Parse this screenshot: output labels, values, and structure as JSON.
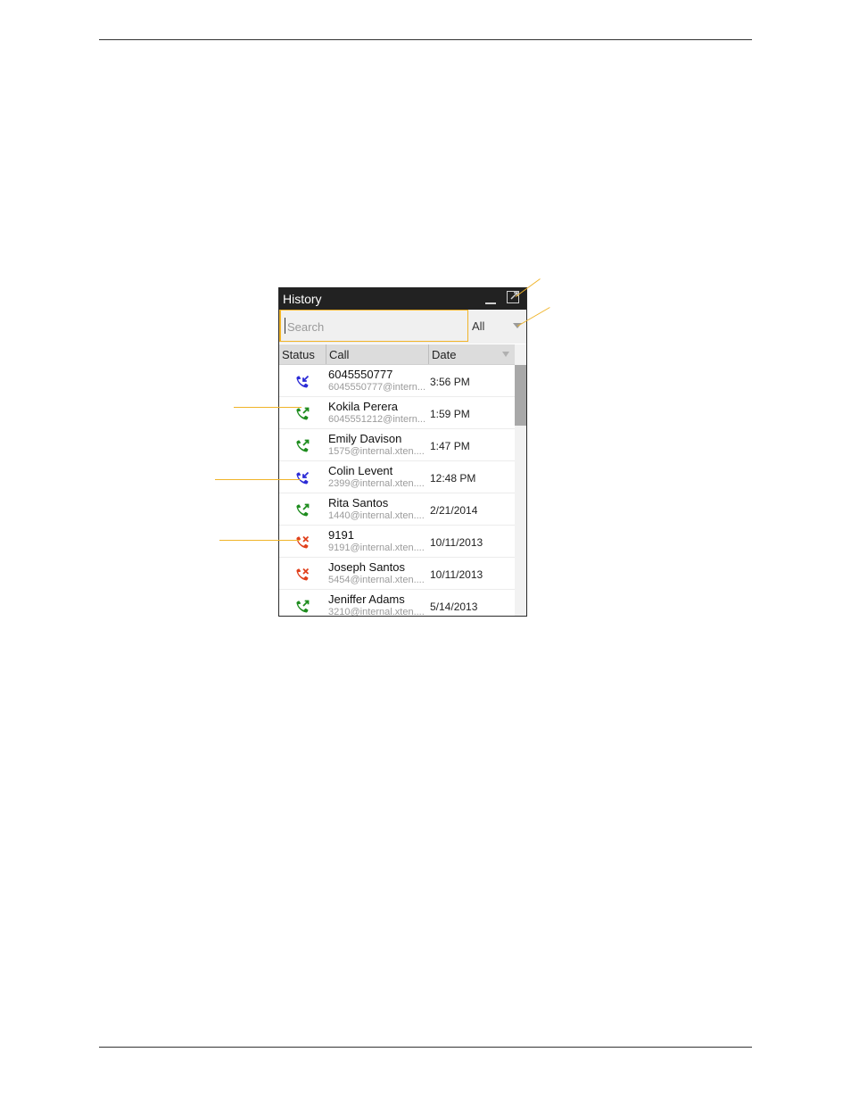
{
  "window": {
    "title": "History"
  },
  "search": {
    "placeholder": "Search"
  },
  "filter": {
    "selected": "All"
  },
  "columns": {
    "status": "Status",
    "call": "Call",
    "date": "Date"
  },
  "colors": {
    "incoming": "#2b2bd6",
    "outgoing": "#1e8c1e",
    "missed": "#e0401c",
    "callout": "#f0b429"
  },
  "rows": [
    {
      "name": "6045550777",
      "addr": "6045550777@intern...",
      "date": "3:56 PM",
      "type": "incoming"
    },
    {
      "name": "Kokila Perera",
      "addr": "6045551212@intern...",
      "date": "1:59 PM",
      "type": "outgoing"
    },
    {
      "name": "Emily Davison",
      "addr": "1575@internal.xten....",
      "date": "1:47 PM",
      "type": "outgoing"
    },
    {
      "name": "Colin Levent",
      "addr": "2399@internal.xten....",
      "date": "12:48 PM",
      "type": "incoming"
    },
    {
      "name": "Rita Santos",
      "addr": "1440@internal.xten....",
      "date": "2/21/2014",
      "type": "outgoing"
    },
    {
      "name": "9191",
      "addr": "9191@internal.xten....",
      "date": "10/11/2013",
      "type": "missed"
    },
    {
      "name": "Joseph  Santos",
      "addr": "5454@internal.xten....",
      "date": "10/11/2013",
      "type": "missed"
    },
    {
      "name": "Jeniffer Adams",
      "addr": "3210@internal.xten....",
      "date": "5/14/2013",
      "type": "outgoing"
    }
  ]
}
